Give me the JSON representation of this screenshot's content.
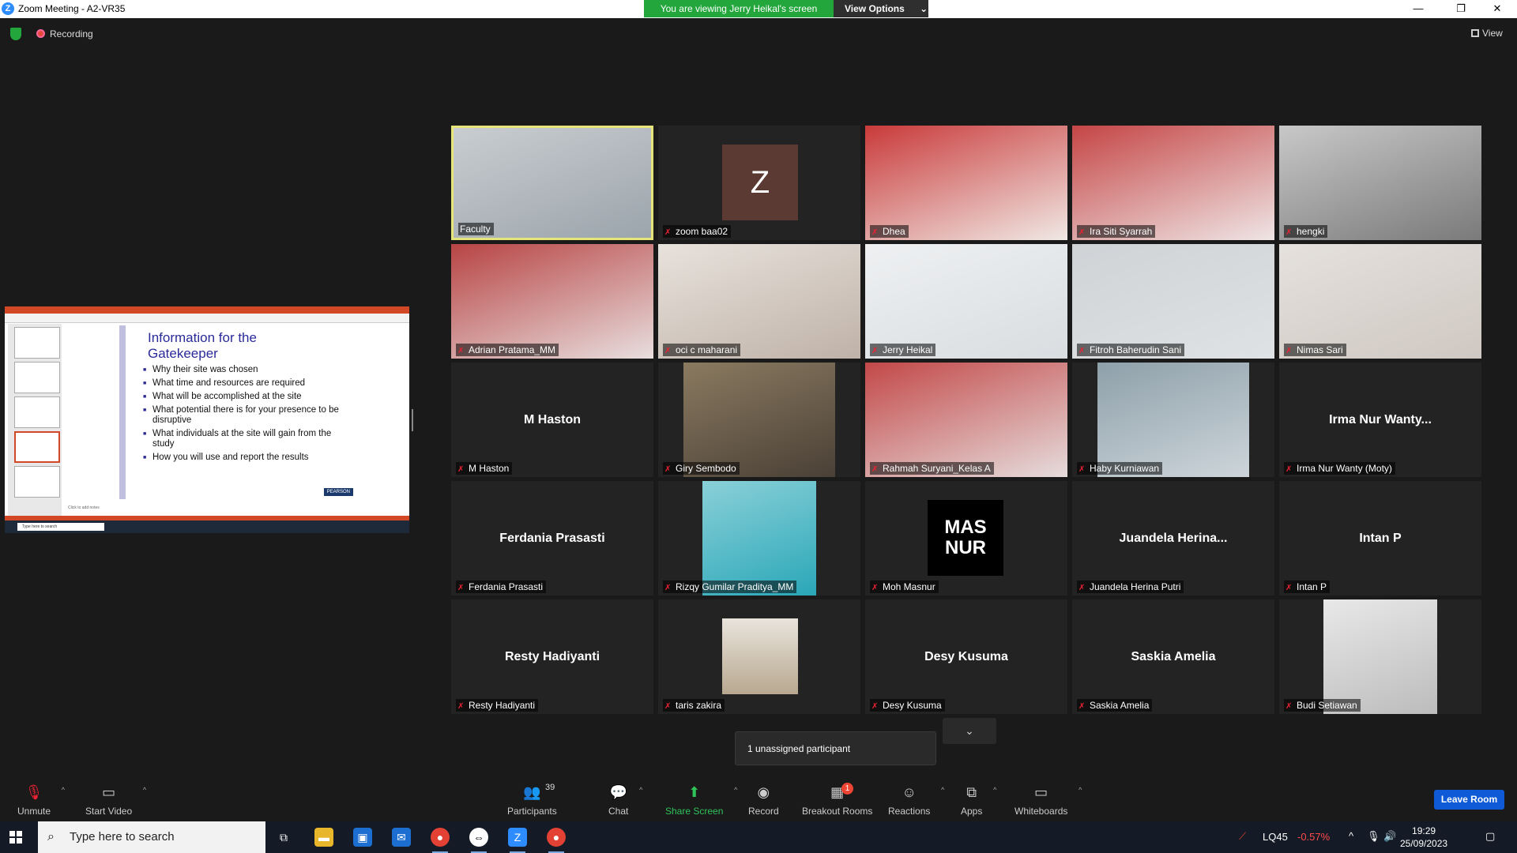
{
  "window": {
    "title": "Zoom Meeting - A2-VR35",
    "share_banner": "You are viewing Jerry Heikal's screen",
    "view_options": "View Options",
    "view_label": "View",
    "recording_label": "Recording"
  },
  "shared_slide": {
    "title": "Information for the Gatekeeper",
    "bullets": [
      "Why their site was chosen",
      "What time and resources are required",
      "What will be accomplished at the site",
      "What potential there is for your presence to be disruptive",
      "What individuals at the site will gain from the study",
      "How you will use and report the results"
    ],
    "publisher": "PEARSON",
    "notes_placeholder": "Click to add notes",
    "taskbar_search": "Type here to search"
  },
  "participants": [
    {
      "name": "Faculty",
      "kind": "video",
      "active": true
    },
    {
      "name": "zoom baa02",
      "kind": "avatar",
      "avatar_letter": "Z"
    },
    {
      "name": "Dhea",
      "kind": "video"
    },
    {
      "name": "Ira Siti Syarrah",
      "kind": "video"
    },
    {
      "name": "hengki",
      "kind": "video"
    },
    {
      "name": "Adrian Pratama_MM",
      "kind": "video"
    },
    {
      "name": "oci c maharani",
      "kind": "video"
    },
    {
      "name": "Jerry Heikal",
      "kind": "video"
    },
    {
      "name": "Fitroh Baherudin Sani",
      "kind": "video"
    },
    {
      "name": "Nimas Sari",
      "kind": "video"
    },
    {
      "name": "M Haston",
      "kind": "name",
      "center": "M Haston"
    },
    {
      "name": "Giry Sembodo",
      "kind": "video"
    },
    {
      "name": "Rahmah Suryani_Kelas A",
      "kind": "video"
    },
    {
      "name": "Haby Kurniawan",
      "kind": "video"
    },
    {
      "name": "Irma Nur Wanty (Moty)",
      "kind": "name",
      "center": "Irma Nur Wanty..."
    },
    {
      "name": "Ferdania Prasasti",
      "kind": "name",
      "center": "Ferdania Prasasti"
    },
    {
      "name": "Rizqy Gumilar Praditya_MM",
      "kind": "video"
    },
    {
      "name": "Moh Masnur",
      "kind": "logo",
      "logo_text": "MAS NUR"
    },
    {
      "name": "Juandela Herina Putri",
      "kind": "name",
      "center": "Juandela  Herina..."
    },
    {
      "name": "Intan P",
      "kind": "name",
      "center": "Intan P"
    },
    {
      "name": "Resty Hadiyanti",
      "kind": "name",
      "center": "Resty Hadiyanti"
    },
    {
      "name": "taris zakira",
      "kind": "photo"
    },
    {
      "name": "Desy Kusuma",
      "kind": "name",
      "center": "Desy Kusuma"
    },
    {
      "name": "Saskia Amelia",
      "kind": "name",
      "center": "Saskia Amelia"
    },
    {
      "name": "Budi Setiawan",
      "kind": "video"
    }
  ],
  "unassigned": "1 unassigned participant",
  "toolbar": {
    "unmute": "Unmute",
    "start_video": "Start Video",
    "participants": "Participants",
    "participants_count": "39",
    "chat": "Chat",
    "share_screen": "Share Screen",
    "record": "Record",
    "breakout_rooms": "Breakout Rooms",
    "breakout_badge": "1",
    "reactions": "Reactions",
    "apps": "Apps",
    "whiteboards": "Whiteboards",
    "leave": "Leave Room"
  },
  "taskbar": {
    "search_placeholder": "Type here to search",
    "stock_symbol": "LQ45",
    "stock_change": "-0.57%",
    "time": "19:29",
    "date": "25/09/2023"
  },
  "colors": {
    "share_green": "#23a73d",
    "active_border": "#e5e57a",
    "leave_blue": "#0e5ad7",
    "muted_red": "#e23333"
  }
}
